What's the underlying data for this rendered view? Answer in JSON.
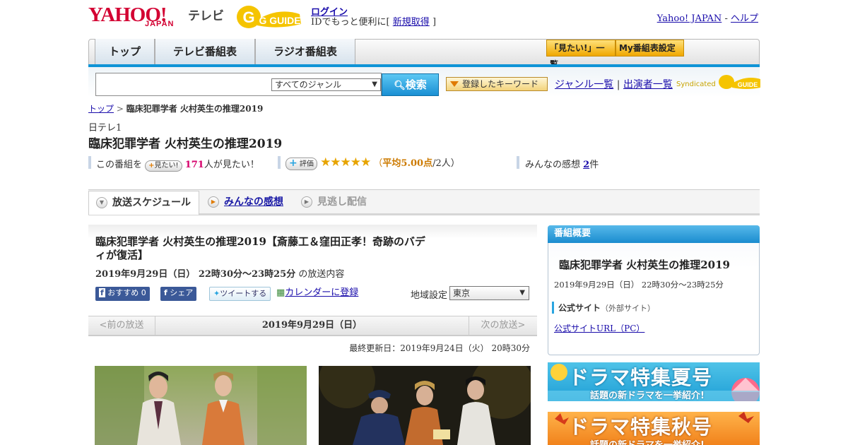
{
  "header": {
    "logo_text": "YAHOO!",
    "logo_sub": "JAPAN",
    "service": "テレビ",
    "gguide_logo": "G GUIDE",
    "login": "ログイン",
    "id_prefix": "IDでもっと便利に[",
    "signup": "新規取得",
    "id_suffix": "]",
    "yahoo_japan": "Yahoo! JAPAN",
    "dash": "-",
    "help": "ヘルプ"
  },
  "nav": {
    "tabs": [
      "トップ",
      "テレビ番組表",
      "ラジオ番組表"
    ],
    "want_list": "「見たい!」一覧",
    "my_settings": "My番組表設定"
  },
  "search": {
    "genre_selected": "すべてのジャンル",
    "button": "検索",
    "keyword_button": "登録したキーワード",
    "genre_list": "ジャンル一覧",
    "divider": "|",
    "cast_list": "出演者一覧",
    "syndicated": "Syndicated"
  },
  "breadcrumb": {
    "top": "トップ",
    "sep": ">",
    "current": "臨床犯罪学者 火村英生の推理2019"
  },
  "program": {
    "channel": "日テレ1",
    "title": "臨床犯罪学者 火村英生の推理2019",
    "want_prefix": "この番組を",
    "want_button": "見たい!",
    "want_count": "171",
    "want_suffix": "人が見たい！",
    "rating_label": "評価",
    "stars": "★★★★★",
    "avg_open": "（",
    "avg": "平均5.00点",
    "avg_people": "/2人）",
    "impressions_label": "みんなの感想",
    "impressions_count": "2",
    "impressions_unit": "件"
  },
  "tabs": {
    "schedule": "放送スケジュール",
    "impressions": "みんなの感想",
    "missed": "見逃し配信"
  },
  "episode": {
    "title": "臨床犯罪学者 火村英生の推理2019【斎藤工＆窪田正孝！奇跡のバディが復活】",
    "date_time": "2019年9月29日（日） 22時30分～23時25分",
    "date_suffix": "の放送内容",
    "recommend": "おすすめ",
    "recommend_count": "0",
    "share": "シェア",
    "tweet": "ツイートする",
    "calendar": "カレンダーに登録",
    "region_label": "地域設定",
    "region_value": "東京",
    "prev": "<前の放送",
    "current_day": "2019年9月29日（日）",
    "next": "次の放送>",
    "updated": "最終更新日：2019年9月24日（火） 20時30分"
  },
  "sidebar": {
    "heading": "番組概要",
    "title": "臨床犯罪学者 火村英生の推理2019",
    "date_time": "2019年9月29日（日） 22時30分～23時25分",
    "official_label": "公式サイト",
    "official_note": "（外部サイト）",
    "official_link": "公式サイトURL（PC）",
    "banner1_main": "ドラマ特集夏号",
    "banner1_sub": "話題の新ドラマを一挙紹介!",
    "banner2_main": "ドラマ特集秋号",
    "banner2_sub": "話題の新ドラマを一挙紹介!"
  },
  "colors": {
    "brand_red": "#d30032",
    "accent_blue": "#0f94d6",
    "star": "#e7a400",
    "pink": "#d6006b"
  }
}
